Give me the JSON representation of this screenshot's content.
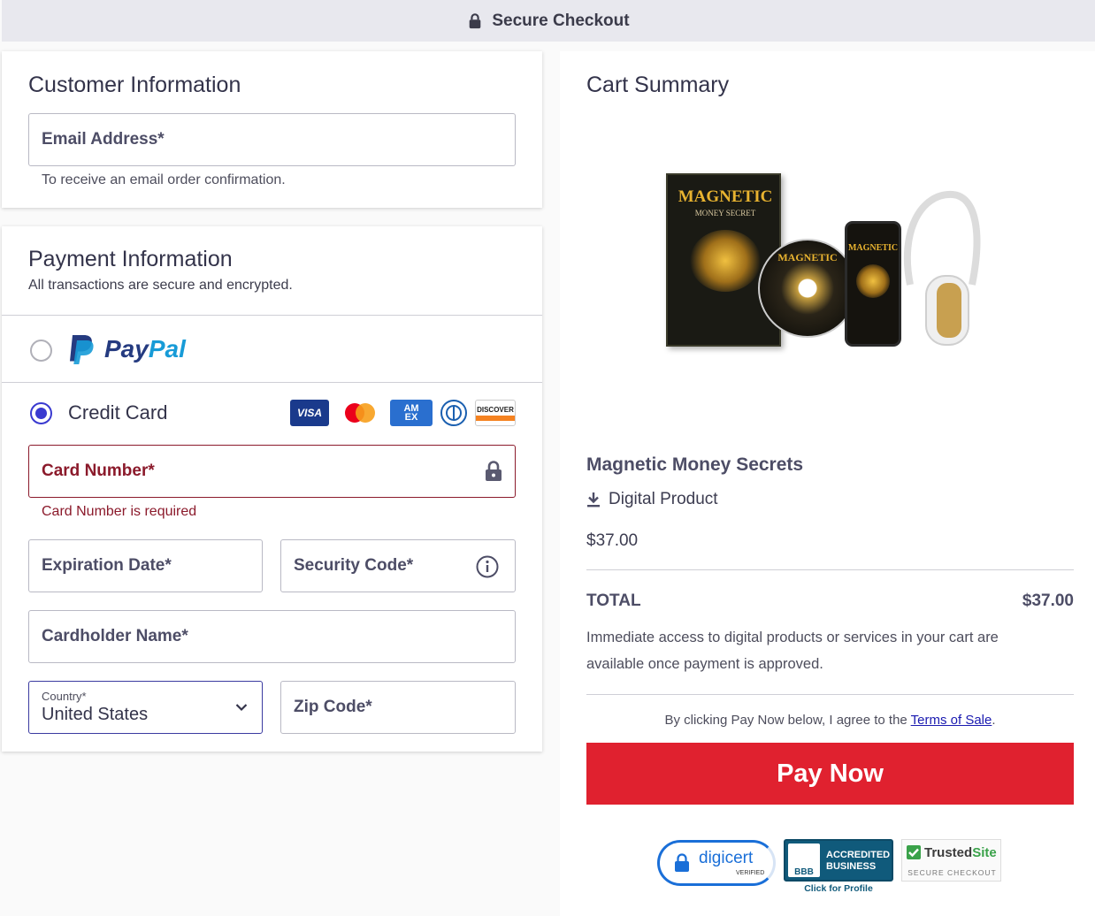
{
  "header": {
    "title": "Secure Checkout",
    "icon": "lock-icon"
  },
  "customer": {
    "title": "Customer Information",
    "email": {
      "label": "Email Address*",
      "hint": "To receive an email order confirmation."
    }
  },
  "payment": {
    "title": "Payment Information",
    "subtitle": "All transactions are secure and encrypted.",
    "paypal": {
      "label": "PayPal",
      "pay": "Pay",
      "pal": "Pal",
      "selected": false
    },
    "credit_card": {
      "label": "Credit Card",
      "selected": true
    },
    "card_brands": {
      "visa": "VISA",
      "amex_top": "AM",
      "amex_bottom": "EX",
      "discover": "DISCOVER"
    },
    "card_number": {
      "label": "Card Number*",
      "error": "Card Number is required"
    },
    "expiration": {
      "label": "Expiration Date*"
    },
    "security_code": {
      "label": "Security Code*"
    },
    "cardholder": {
      "label": "Cardholder Name*"
    },
    "country": {
      "label": "Country*",
      "value": "United States"
    },
    "zip": {
      "label": "Zip Code*"
    }
  },
  "cart": {
    "title": "Cart Summary",
    "product_image_text": {
      "box_title": "MAGNETIC",
      "box_sub": "MONEY SECRET",
      "disc_title": "MAGNETIC",
      "phone_title": "MAGNETIC"
    },
    "product_name": "Magnetic Money Secrets",
    "product_type": "Digital Product",
    "price": "$37.00",
    "total_label": "TOTAL",
    "total_value": "$37.00",
    "access_note": "Immediate access to digital products or services in your cart are available once payment is approved.",
    "terms_prefix": "By clicking Pay Now below, I agree to the ",
    "terms_link": "Terms of Sale",
    "terms_suffix": ".",
    "pay_button": "Pay Now"
  },
  "badges": {
    "digicert": {
      "name": "digicert",
      "sub": "VERIFIED"
    },
    "bbb": {
      "line1": "ACCREDITED",
      "line2": "BUSINESS",
      "short": "BBB",
      "cta": "Click for Profile"
    },
    "trustedsite": {
      "name_a": "Trusted",
      "name_b": "Site",
      "sub": "SECURE CHECKOUT"
    }
  },
  "colors": {
    "accent": "#3a3ad0",
    "error": "#8b1a2b",
    "pay_button": "#e0212f",
    "paypal_dark": "#253b80",
    "paypal_light": "#179bd7"
  }
}
